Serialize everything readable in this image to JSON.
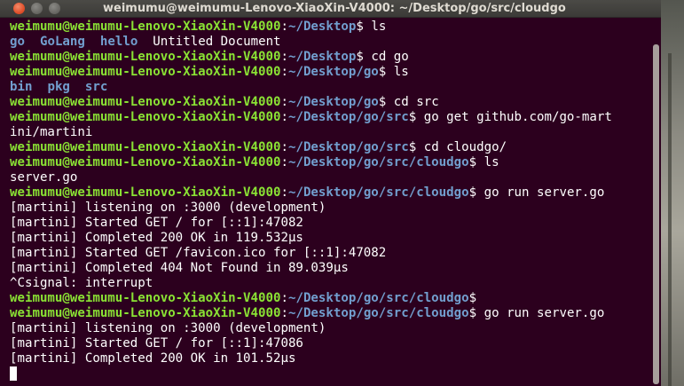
{
  "window": {
    "title": "weimumu@weimumu-Lenovo-XiaoXin-V4000: ~/Desktop/go/src/cloudgo"
  },
  "colors": {
    "background": "#2c001e",
    "user_host": "#8ae234",
    "path": "#729fcf",
    "text": "#ffffff"
  },
  "icons": {
    "close": "close-icon",
    "minimize": "minimize-icon",
    "maximize": "maximize-icon"
  },
  "terminal": {
    "lines": [
      {
        "type": "prompt",
        "user": "weimumu@weimumu-Lenovo-XiaoXin-V4000",
        "path": "~/Desktop",
        "cmd": "ls"
      },
      {
        "type": "ls",
        "items": [
          {
            "text": "go",
            "kind": "dir"
          },
          {
            "text": "GoLang",
            "kind": "dir"
          },
          {
            "text": "hello",
            "kind": "dir"
          },
          {
            "text": "Untitled Document",
            "kind": "file"
          }
        ]
      },
      {
        "type": "prompt",
        "user": "weimumu@weimumu-Lenovo-XiaoXin-V4000",
        "path": "~/Desktop",
        "cmd": "cd go"
      },
      {
        "type": "prompt",
        "user": "weimumu@weimumu-Lenovo-XiaoXin-V4000",
        "path": "~/Desktop/go",
        "cmd": "ls"
      },
      {
        "type": "ls",
        "items": [
          {
            "text": "bin",
            "kind": "dir"
          },
          {
            "text": "pkg",
            "kind": "dir"
          },
          {
            "text": "src",
            "kind": "dir"
          }
        ]
      },
      {
        "type": "prompt",
        "user": "weimumu@weimumu-Lenovo-XiaoXin-V4000",
        "path": "~/Desktop/go",
        "cmd": "cd src"
      },
      {
        "type": "prompt",
        "user": "weimumu@weimumu-Lenovo-XiaoXin-V4000",
        "path": "~/Desktop/go/src",
        "cmd": "go get github.com/go-mart"
      },
      {
        "type": "text",
        "text": "ini/martini"
      },
      {
        "type": "prompt",
        "user": "weimumu@weimumu-Lenovo-XiaoXin-V4000",
        "path": "~/Desktop/go/src",
        "cmd": "cd cloudgo/"
      },
      {
        "type": "prompt",
        "user": "weimumu@weimumu-Lenovo-XiaoXin-V4000",
        "path": "~/Desktop/go/src/cloudgo",
        "cmd": "ls"
      },
      {
        "type": "text",
        "text": "server.go"
      },
      {
        "type": "prompt",
        "user": "weimumu@weimumu-Lenovo-XiaoXin-V4000",
        "path": "~/Desktop/go/src/cloudgo",
        "cmd": "go run server.go"
      },
      {
        "type": "text",
        "text": "[martini] listening on :3000 (development)"
      },
      {
        "type": "text",
        "text": "[martini] Started GET / for [::1]:47082"
      },
      {
        "type": "text",
        "text": "[martini] Completed 200 OK in 119.532µs"
      },
      {
        "type": "text",
        "text": "[martini] Started GET /favicon.ico for [::1]:47082"
      },
      {
        "type": "text",
        "text": "[martini] Completed 404 Not Found in 89.039µs"
      },
      {
        "type": "text",
        "text": "^Csignal: interrupt"
      },
      {
        "type": "prompt",
        "user": "weimumu@weimumu-Lenovo-XiaoXin-V4000",
        "path": "~/Desktop/go/src/cloudgo",
        "cmd": ""
      },
      {
        "type": "prompt",
        "user": "weimumu@weimumu-Lenovo-XiaoXin-V4000",
        "path": "~/Desktop/go/src/cloudgo",
        "cmd": "go run server.go"
      },
      {
        "type": "text",
        "text": "[martini] listening on :3000 (development)"
      },
      {
        "type": "text",
        "text": "[martini] Started GET / for [::1]:47086"
      },
      {
        "type": "text",
        "text": "[martini] Completed 200 OK in 101.52µs"
      },
      {
        "type": "cursor"
      }
    ]
  }
}
